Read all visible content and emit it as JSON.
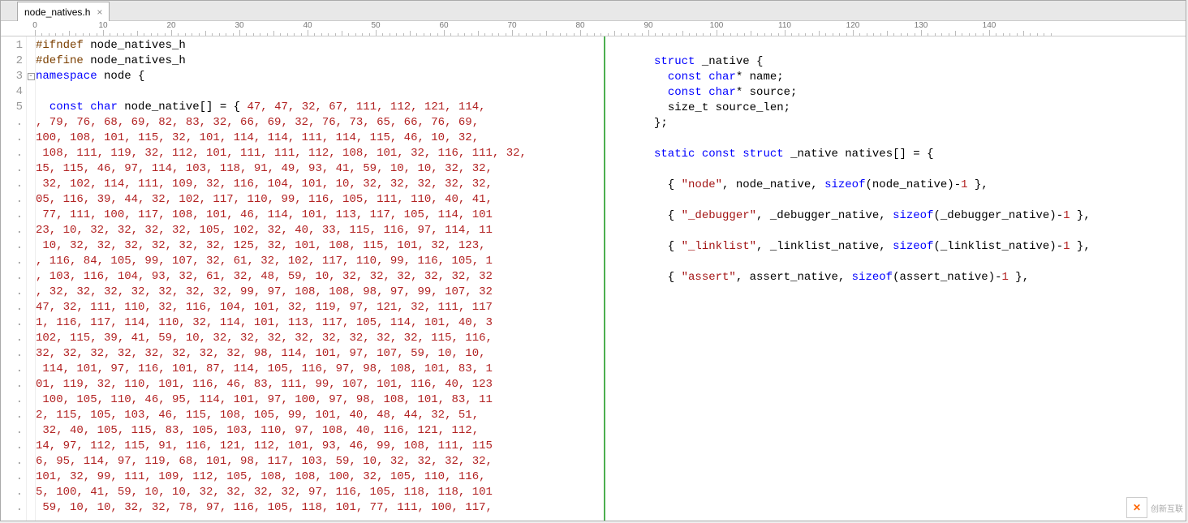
{
  "tab": {
    "filename": "node_natives.h"
  },
  "ruler_ticks": [
    0,
    10,
    20,
    30,
    40,
    50,
    60,
    70,
    80,
    90,
    100,
    110,
    120,
    130,
    140
  ],
  "left_gutter": [
    "1",
    "2",
    "3",
    "4",
    "5",
    ".",
    ".",
    ".",
    ".",
    ".",
    ".",
    ".",
    ".",
    ".",
    ".",
    ".",
    ".",
    ".",
    ".",
    ".",
    ".",
    ".",
    ".",
    ".",
    ".",
    ".",
    ".",
    ".",
    ".",
    ".",
    "."
  ],
  "fold_markers": [
    "",
    "",
    "box",
    "",
    "",
    "",
    "",
    "",
    "",
    "",
    "",
    "",
    "",
    "",
    "",
    "",
    "",
    "",
    "",
    "",
    "",
    "",
    "",
    "",
    "",
    "",
    "",
    "",
    "",
    "",
    ""
  ],
  "left_code": {
    "l1": {
      "pre": "#ifndef ",
      "post": "node_natives_h"
    },
    "l2": {
      "pre": "#define ",
      "post": "node_natives_h"
    },
    "l3": {
      "kw": "namespace",
      "txt": " node {"
    },
    "l5_kw1": "const",
    "l5_kw2": "char",
    "l5_txt": " node_native[] = { ",
    "l5_nums": "47, 47, 32, 67, 111, 112, 121, 114,",
    "nums": [
      ", 79, 76, 68, 69, 82, 83, 32, 66, 69, 32, 76, 73, 65, 66, 76, 69,",
      "100, 108, 101, 115, 32, 101, 114, 114, 111, 114, 115, 46, 10, 32,",
      " 108, 111, 119, 32, 112, 101, 111, 111, 112, 108, 101, 32, 116, 111, 32,",
      "15, 115, 46, 97, 114, 103, 118, 91, 49, 93, 41, 59, 10, 10, 32, 32,",
      " 32, 102, 114, 111, 109, 32, 116, 104, 101, 10, 32, 32, 32, 32, 32,",
      "05, 116, 39, 44, 32, 102, 117, 110, 99, 116, 105, 111, 110, 40, 41,",
      " 77, 111, 100, 117, 108, 101, 46, 114, 101, 113, 117, 105, 114, 101",
      "23, 10, 32, 32, 32, 32, 105, 102, 32, 40, 33, 115, 116, 97, 114, 11",
      " 10, 32, 32, 32, 32, 32, 32, 125, 32, 101, 108, 115, 101, 32, 123,",
      ", 116, 84, 105, 99, 107, 32, 61, 32, 102, 117, 110, 99, 116, 105, 1",
      ", 103, 116, 104, 93, 32, 61, 32, 48, 59, 10, 32, 32, 32, 32, 32, 32",
      ", 32, 32, 32, 32, 32, 32, 32, 99, 97, 108, 108, 98, 97, 99, 107, 32",
      "47, 32, 111, 110, 32, 116, 104, 101, 32, 119, 97, 121, 32, 111, 117",
      "1, 116, 117, 114, 110, 32, 114, 101, 113, 117, 105, 114, 101, 40, 3",
      "102, 115, 39, 41, 59, 10, 32, 32, 32, 32, 32, 32, 32, 32, 115, 116,",
      "32, 32, 32, 32, 32, 32, 32, 32, 98, 114, 101, 97, 107, 59, 10, 10,",
      " 114, 101, 97, 116, 101, 87, 114, 105, 116, 97, 98, 108, 101, 83, 1",
      "01, 119, 32, 110, 101, 116, 46, 83, 111, 99, 107, 101, 116, 40, 123",
      " 100, 105, 110, 46, 95, 114, 101, 97, 100, 97, 98, 108, 101, 83, 11",
      "2, 115, 105, 103, 46, 115, 108, 105, 99, 101, 40, 48, 44, 32, 51,",
      " 32, 40, 105, 115, 83, 105, 103, 110, 97, 108, 40, 116, 121, 112,",
      "14, 97, 112, 115, 91, 116, 121, 112, 101, 93, 46, 99, 108, 111, 115",
      "6, 95, 114, 97, 119, 68, 101, 98, 117, 103, 59, 10, 32, 32, 32, 32,",
      "101, 32, 99, 111, 109, 112, 105, 108, 108, 100, 32, 105, 110, 116,",
      "5, 100, 41, 59, 10, 10, 32, 32, 32, 32, 97, 116, 105, 118, 118, 101",
      " 59, 10, 10, 32, 32, 78, 97, 116, 105, 118, 101, 77, 111, 100, 117,"
    ]
  },
  "right_code": {
    "struct_kw": "struct",
    "struct_name": " _native {",
    "f1_kw1": "const",
    "f1_kw2": "char",
    "f1_rest": "* name;",
    "f2_kw1": "const",
    "f2_kw2": "char",
    "f2_rest": "* source;",
    "f3": "size_t source_len;",
    "close": "};",
    "decl": {
      "kw1": "static",
      "kw2": "const",
      "kw3": "struct",
      "rest": " _native natives[] = {"
    },
    "entries": [
      {
        "indent": "  { ",
        "str": "\"node\"",
        "mid": ", node_native, ",
        "sz": "sizeof",
        "call": "(node_native)-",
        "one": "1",
        "end": " },"
      },
      {
        "indent": "  { ",
        "str": "\"_debugger\"",
        "mid": ", _debugger_native, ",
        "sz": "sizeof",
        "call": "(_debugger_native)-",
        "one": "1",
        "end": " },"
      },
      {
        "indent": "  { ",
        "str": "\"_linklist\"",
        "mid": ", _linklist_native, ",
        "sz": "sizeof",
        "call": "(_linklist_native)-",
        "one": "1",
        "end": " },"
      },
      {
        "indent": "  { ",
        "str": "\"assert\"",
        "mid": ", assert_native, ",
        "sz": "sizeof",
        "call": "(assert_native)-",
        "one": "1",
        "end": " },"
      }
    ]
  },
  "watermark": "创新互联"
}
